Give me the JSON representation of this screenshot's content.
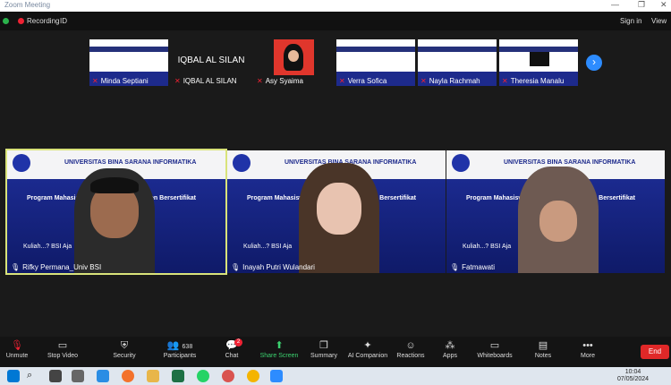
{
  "window": {
    "title": "Zoom Meeting"
  },
  "topbar": {
    "recording": "Recording",
    "id": "ID",
    "signin": "Sign in",
    "view": "View"
  },
  "strip": [
    {
      "name": "Minda Septiani"
    },
    {
      "name": "IQBAL AL SILAN",
      "big": "IQBAL AL SILAN"
    },
    {
      "name": "Asy Syaima"
    },
    {
      "name": "Verra Sofica"
    },
    {
      "name": "Nayla Rachmah"
    },
    {
      "name": "Theresia Manalu"
    }
  ],
  "slide": {
    "univ": "UNIVERSITAS BINA SARANA INFORMATIKA",
    "program": "Program Mahasiswa Wirausaha Independen Bersertifikat",
    "tag": "Kuliah...? BSI Aja",
    "short_univ": "UNIVERSITAS"
  },
  "tiles": [
    {
      "name": "Rifky Permana_Univ BSI"
    },
    {
      "name": "Inayah Putri Wulandari"
    },
    {
      "name": "Fatmawati"
    }
  ],
  "toolbar": {
    "unmute": "Unmute",
    "stop_video": "Stop Video",
    "security": "Security",
    "participants": "Participants",
    "participants_count": "638",
    "chat": "Chat",
    "chat_badge": "2",
    "share": "Share Screen",
    "summary": "Summary",
    "ai": "AI Companion",
    "reactions": "Reactions",
    "apps": "Apps",
    "whiteboards": "Whiteboards",
    "notes": "Notes",
    "more": "More",
    "end": "End"
  },
  "taskbar": {
    "time": "10:04",
    "date": "07/05/2024"
  }
}
